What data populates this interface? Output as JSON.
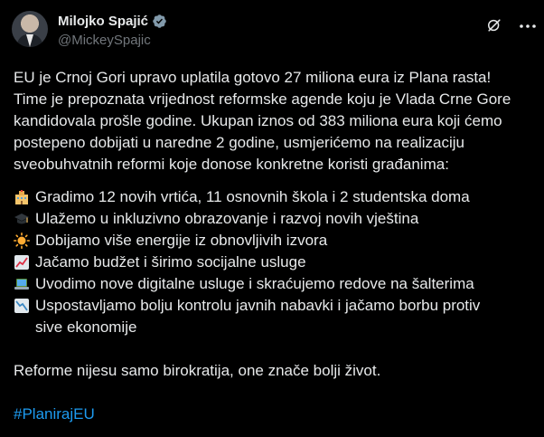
{
  "author": {
    "name": "Milojko Spajić",
    "handle": "@MickeySpajic"
  },
  "tweet": {
    "intro": "EU je Crnoj Gori upravo uplatila gotovo 27 miliona eura iz Plana rasta!\nTime je prepoznata vrijednost reformske agende koju je Vlada Crne Gore\nkandidovala prošle godine. Ukupan iznos od 383 miliona eura koji ćemo\npostepeno dobijati u naredne 2 godine, usmjerićemo na realizaciju\nsveobuhvatnih reformi koje donose konkretne koristi građanima:",
    "items": [
      {
        "icon": "school-building-icon",
        "text": "Gradimo 12 novih vrtića, 11 osnovnih škola i 2 studentska doma"
      },
      {
        "icon": "graduation-cap-icon",
        "text": "Ulažemo u inkluzivno obrazovanje i razvoj novih vještina"
      },
      {
        "icon": "sun-icon",
        "text": "Dobijamo više energije iz obnovljivih izvora"
      },
      {
        "icon": "chart-increasing-icon",
        "text": "Jačamo budžet i širimo socijalne usluge"
      },
      {
        "icon": "laptop-icon",
        "text": "Uvodimo nove digitalne usluge i skraćujemo redove na šalterima"
      },
      {
        "icon": "chart-decreasing-icon",
        "text": "Uspostavljamo bolju kontrolu javnih nabavki i jačamo borbu protiv\nsive ekonomije"
      }
    ],
    "closing": "Reforme nijesu samo birokratija, one znače bolji život.",
    "hashtag": "#PlanirajEU"
  },
  "colors": {
    "background": "#000000",
    "text": "#e7e9ea",
    "secondary_text": "#71767b",
    "link": "#1d9bf0",
    "verified": "#829aab"
  }
}
